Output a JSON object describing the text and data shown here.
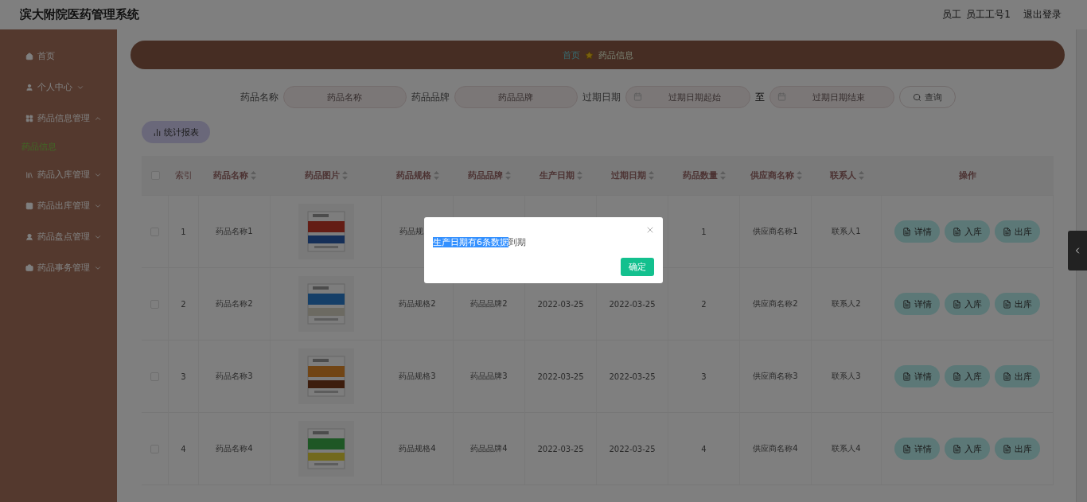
{
  "header": {
    "title": "滨大附院医药管理系统",
    "user_role": "员工",
    "user_name": "员工工号1",
    "logout": "退出登录"
  },
  "sidebar": {
    "items": [
      {
        "kind": "link",
        "label": "首页",
        "selected": false
      },
      {
        "kind": "menu",
        "label": "个人中心",
        "expanded": false
      },
      {
        "kind": "menu",
        "label": "药品信息管理",
        "expanded": true,
        "children": [
          {
            "label": "药品信息",
            "selected": true
          }
        ]
      },
      {
        "kind": "menu",
        "label": "药品入库管理",
        "expanded": false
      },
      {
        "kind": "menu",
        "label": "药品出库管理",
        "expanded": false
      },
      {
        "kind": "menu",
        "label": "药品盘点管理",
        "expanded": false
      },
      {
        "kind": "menu",
        "label": "药品事务管理",
        "expanded": false
      }
    ]
  },
  "breadcrumb": [
    "首页",
    "药品信息"
  ],
  "search": {
    "fields": [
      {
        "kind": "text",
        "label": "药品名称",
        "placeholder": "药品名称"
      },
      {
        "kind": "text",
        "label": "药品品牌",
        "placeholder": "药品品牌"
      },
      {
        "kind": "date_range",
        "label": "过期日期",
        "placeholder": "过期日期起始",
        "separator": "至",
        "placeholder_end": "过期日期结束"
      }
    ],
    "button": "查询"
  },
  "report_button": "统计报表",
  "table": {
    "columns": [
      "索引",
      "药品名称",
      "药品图片",
      "药品规格",
      "药品品牌",
      "生产日期",
      "过期日期",
      "药品数量",
      "供应商名称",
      "联系人",
      "操作"
    ],
    "header_checked": false,
    "rows": [
      {
        "checked": false,
        "index": "1",
        "name": "药品名称1",
        "spec": "药品规",
        "quantity": "1",
        "supplier": "供应商名称1",
        "contact": "联系人1",
        "actions": [
          "详情",
          "入库",
          "出库"
        ]
      },
      {
        "checked": false,
        "index": "2",
        "name": "药品名称2",
        "spec": "药品规格2",
        "brand": "药品品牌2",
        "produced": "2022-03-25",
        "expires": "2022-03-25",
        "quantity": "2",
        "supplier": "供应商名称2",
        "contact": "联系人2",
        "actions": [
          "详情",
          "入库",
          "出库"
        ]
      },
      {
        "checked": false,
        "index": "3",
        "name": "药品名称3",
        "spec": "药品规格3",
        "brand": "药品品牌3",
        "produced": "2022-03-25",
        "expires": "2022-03-25",
        "quantity": "3",
        "supplier": "供应商名称3",
        "contact": "联系人3",
        "actions": [
          "详情",
          "入库",
          "出库"
        ]
      },
      {
        "checked": false,
        "index": "4",
        "name": "药品名称4",
        "spec": "药品规格4",
        "brand": "药品品牌4",
        "produced": "2022-03-25",
        "expires": "2022-03-25",
        "quantity": "4",
        "supplier": "供应商名称4",
        "contact": "联系人4",
        "actions": [
          "详情",
          "入库",
          "出库"
        ]
      }
    ]
  },
  "dialog": {
    "message_selected": "生产日期有6条数据",
    "message_rest": "到期",
    "button": "确定"
  }
}
